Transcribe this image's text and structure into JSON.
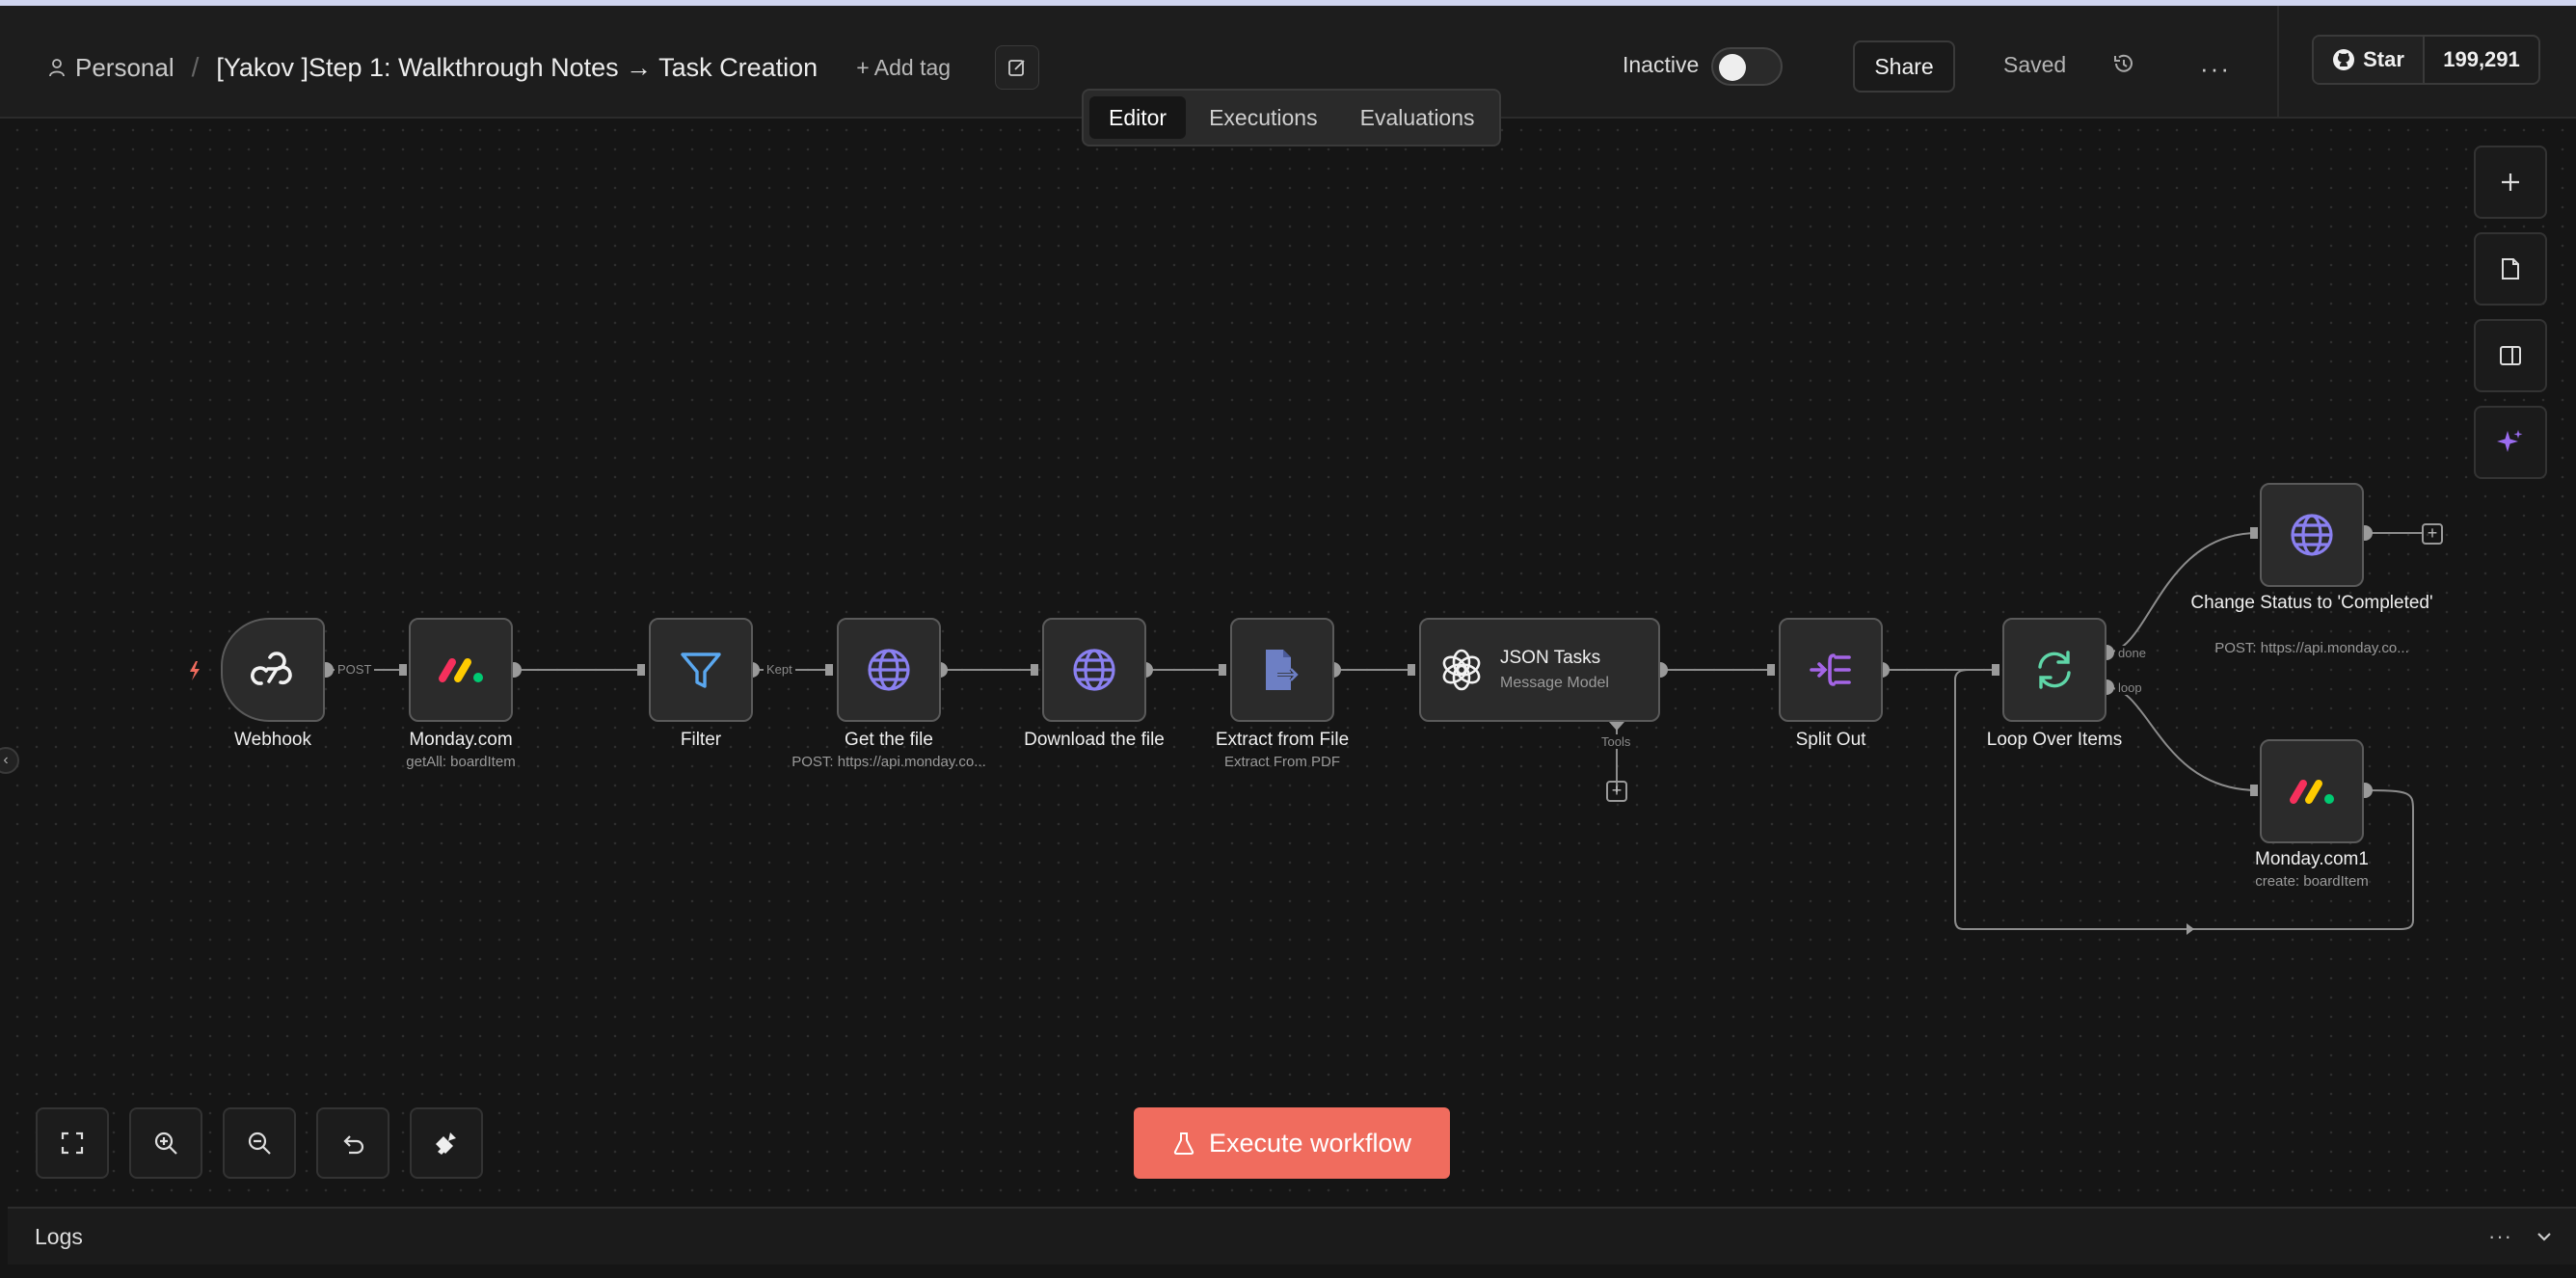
{
  "header": {
    "workspace": "Personal",
    "separator": "/",
    "workflow_title": "[Yakov ]Step 1: Walkthrough Notes → Task Creation",
    "add_tag": "+ Add tag",
    "status_label": "Inactive",
    "share_label": "Share",
    "saved_label": "Saved",
    "more_label": "···",
    "github_star_label": "Star",
    "github_star_count": "199,291"
  },
  "tabs": [
    {
      "label": "Editor",
      "active": true
    },
    {
      "label": "Executions",
      "active": false
    },
    {
      "label": "Evaluations",
      "active": false
    }
  ],
  "nodes": {
    "webhook": {
      "label": "Webhook",
      "icon": "webhook-icon"
    },
    "monday": {
      "label": "Monday.com",
      "subtitle": "getAll: boardItem",
      "icon": "monday-icon"
    },
    "filter": {
      "label": "Filter",
      "icon": "filter-icon"
    },
    "get_file": {
      "label": "Get the file",
      "subtitle": "POST: https://api.monday.co...",
      "icon": "globe-icon"
    },
    "download_file": {
      "label": "Download the file",
      "icon": "globe-icon"
    },
    "extract": {
      "label": "Extract from File",
      "subtitle": "Extract From PDF",
      "icon": "extract-file-icon"
    },
    "json_tasks": {
      "label": "JSON Tasks",
      "subtitle": "Message Model",
      "icon": "openai-icon"
    },
    "split_out": {
      "label": "Split Out",
      "icon": "split-out-icon"
    },
    "loop": {
      "label": "Loop Over Items",
      "icon": "loop-icon"
    },
    "change_status": {
      "label": "Change Status to 'Completed'",
      "subtitle": "POST: https://api.monday.co...",
      "icon": "globe-icon"
    },
    "monday1": {
      "label": "Monday.com1",
      "subtitle": "create: boardItem",
      "icon": "monday-icon"
    }
  },
  "edge_labels": {
    "post": "POST",
    "kept": "Kept",
    "tools": "Tools",
    "done": "done",
    "loop": "loop"
  },
  "execute_label": "Execute workflow",
  "logs": {
    "label": "Logs",
    "more": "···"
  },
  "colors": {
    "accent": "#f06c5e",
    "canvas": "#151515",
    "node_bg": "#2b2b2b",
    "globe": "#8a80f0",
    "filter": "#5aa8f0",
    "loop": "#5fd6a8",
    "split": "#a465e6"
  }
}
